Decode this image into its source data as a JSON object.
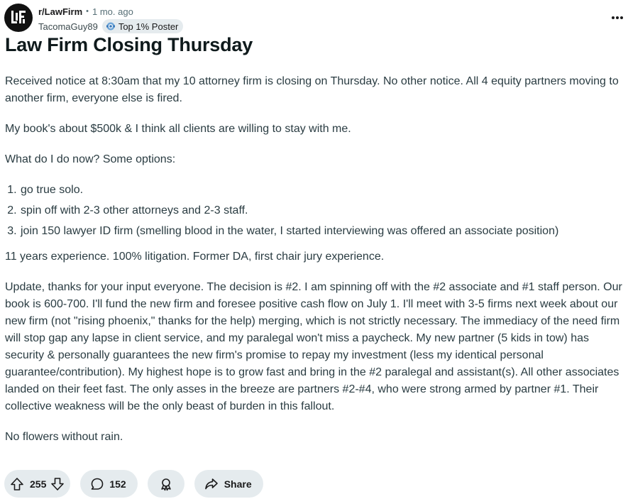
{
  "post": {
    "subreddit": "r/LawFirm",
    "separator": "•",
    "time_ago": "1 mo. ago",
    "author": "TacomaGuy89",
    "author_flair": "Top 1% Poster",
    "title": "Law Firm Closing Thursday",
    "paragraphs": [
      "Received notice at 8:30am that my 10 attorney firm is closing on Thursday. No other notice. All 4 equity partners moving to another firm, everyone else is fired.",
      "My book's about $500k & I think all clients are willing to stay with me.",
      "What do I do now? Some options:"
    ],
    "options": [
      "go true solo.",
      "spin off with 2-3 other attorneys and 2-3 staff.",
      "join 150 lawyer ID firm (smelling blood in the water, I started interviewing was offered an associate position)"
    ],
    "paragraphs_after": [
      "11 years experience. 100% litigation. Former DA, first chair jury experience.",
      "Update, thanks for your input everyone. The decision is #2. I am spinning off with the #2 associate and #1 staff person. Our book is 600-700. I'll fund the new firm and foresee positive cash flow on July 1. I'll meet with 3-5 firms next week about our new firm (not \"rising phoenix,\" thanks for the help) merging, which is not strictly necessary. The immediacy of the need firm will stop gap any lapse in client service, and my paralegal won't miss a paycheck. My new partner (5 kids in tow) has security & personally guarantees the new firm's promise to repay my investment (less my identical personal guarantee/contribution). My highest hope is to grow fast and bring in the #2 paralegal and assistant(s). All other associates landed on their feet fast. The only asses in the breeze are partners #2-#4, who were strong armed by partner #1. Their collective weakness will be the only beast of burden in this fallout.",
      "No flowers without rain."
    ]
  },
  "actions": {
    "upvotes": "255",
    "comments": "152",
    "share_label": "Share"
  },
  "icons": {
    "avatar": "law-firm-logo-icon",
    "flair": "achievement-badge-icon",
    "more": "more-options-icon",
    "upvote": "upvote-arrow-icon",
    "downvote": "downvote-arrow-icon",
    "comment": "comment-bubble-icon",
    "award": "award-icon",
    "share": "share-arrow-icon"
  },
  "colors": {
    "pill_bg": "#e5ebee",
    "text_primary": "#1a1a1b",
    "text_meta": "#576f76"
  }
}
